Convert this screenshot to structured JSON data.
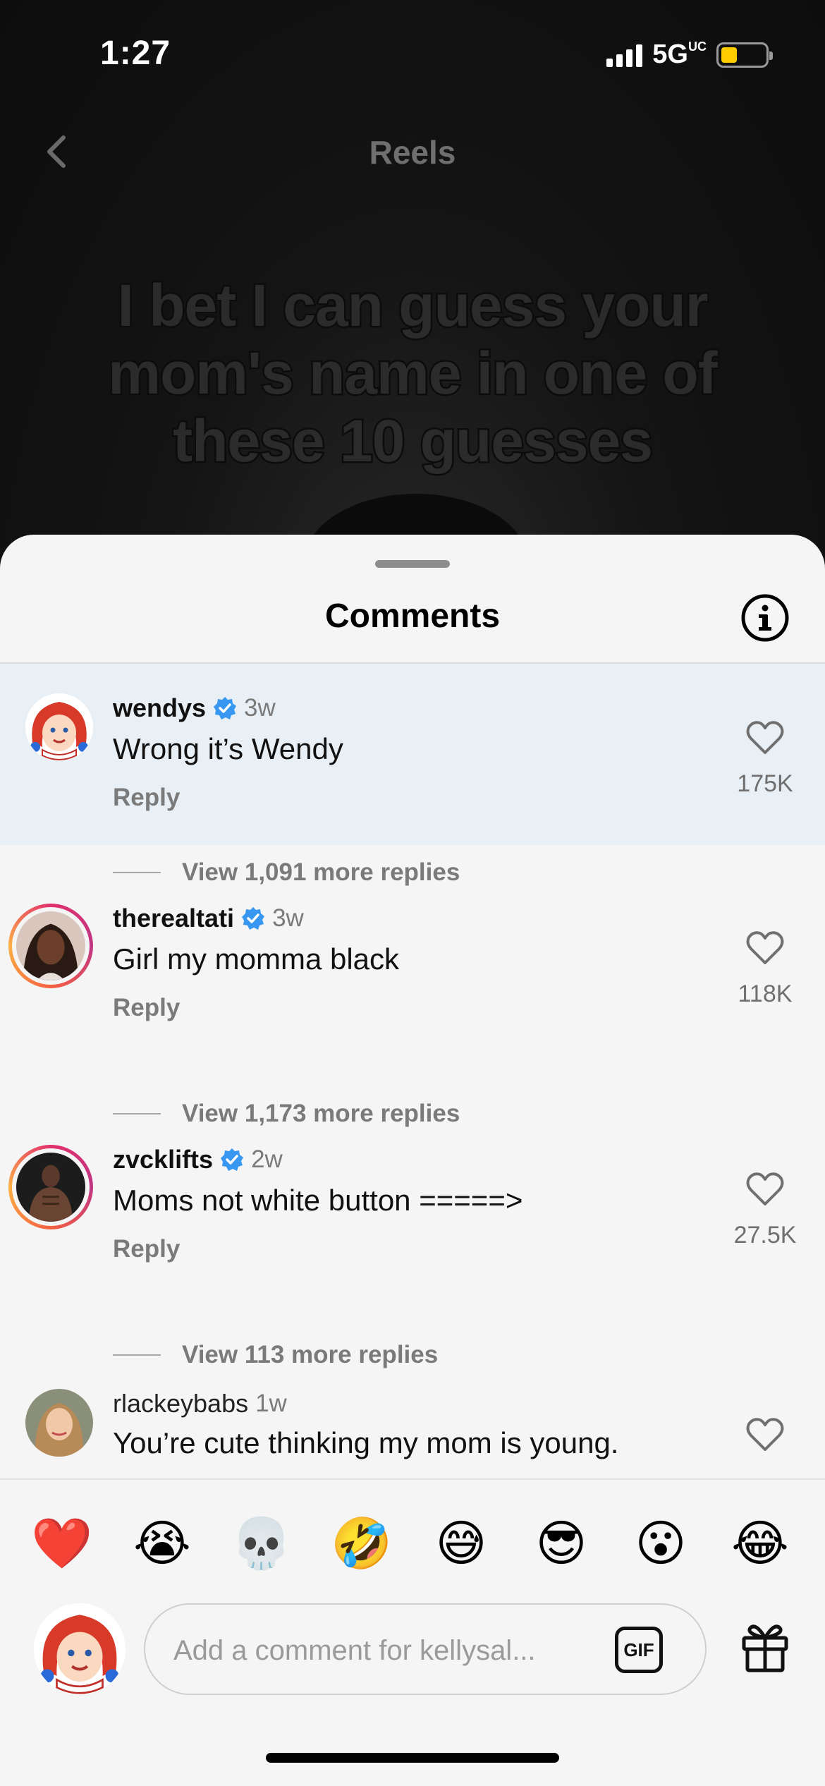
{
  "status_bar": {
    "time": "1:27",
    "network": "5G",
    "network_superscript": "UC",
    "battery_color": "#ffcc00"
  },
  "nav": {
    "title": "Reels",
    "back_icon": "chevron-left-icon"
  },
  "video": {
    "caption": "I bet I can guess your mom's name in one of these 10 guesses"
  },
  "sheet": {
    "title": "Comments",
    "info_icon": "info-icon"
  },
  "comments": [
    {
      "username": "wendys",
      "verified": true,
      "time": "3w",
      "text": "Wrong it’s Wendy",
      "reply_label": "Reply",
      "likes": "175K",
      "view_replies": "View 1,091 more replies",
      "highlighted": true
    },
    {
      "username": "therealtati",
      "verified": true,
      "time": "3w",
      "text": "Girl my momma black",
      "reply_label": "Reply",
      "likes": "118K",
      "view_replies": "View 1,173 more replies"
    },
    {
      "username": "zvcklifts",
      "verified": true,
      "time": "2w",
      "text": "Moms not white button =====>",
      "reply_label": "Reply",
      "likes": "27.5K",
      "view_replies": "View 113 more replies"
    },
    {
      "username": "rlackeybabs",
      "verified": false,
      "time": "1w",
      "text": "You’re cute thinking my mom is young."
    }
  ],
  "emoji_bar": [
    "❤️",
    "😭",
    "💀",
    "🤣",
    "😅",
    "😎",
    "😮",
    "😂"
  ],
  "composer": {
    "placeholder": "Add a comment for kellysal...",
    "gif_label": "GIF",
    "gift_icon": "gift-icon"
  },
  "colors": {
    "verified_blue": "#3897f0",
    "highlight_bg": "#e9f0f5",
    "sheet_bg": "#f5f5f5"
  }
}
